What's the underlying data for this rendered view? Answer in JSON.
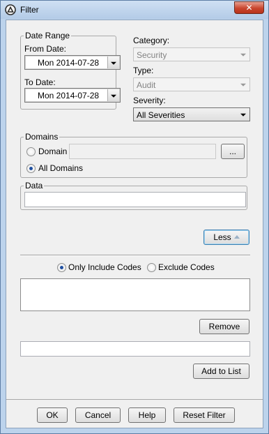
{
  "window": {
    "title": "Filter",
    "close_glyph": "✕",
    "app_icon": "filter-app-icon",
    "close_icon": "close-icon"
  },
  "date_range": {
    "legend": "Date Range",
    "from_label": "From Date:",
    "from_value": "Mon 2014-07-28",
    "to_label": "To Date:",
    "to_value": "Mon 2014-07-28"
  },
  "category": {
    "label": "Category:",
    "value": "Security",
    "enabled": false
  },
  "type": {
    "label": "Type:",
    "value": "Audit",
    "enabled": false
  },
  "severity": {
    "label": "Severity:",
    "value": "All Severities",
    "enabled": true
  },
  "domains": {
    "legend": "Domains",
    "domain_label": "Domain",
    "domain_value": "",
    "browse_label": "...",
    "all_label": "All Domains",
    "selected": "All Domains"
  },
  "data_group": {
    "legend": "Data",
    "value": ""
  },
  "less_button": {
    "label": "Less"
  },
  "codes": {
    "include_label": "Only Include Codes",
    "exclude_label": "Exclude Codes",
    "selected": "Only Include Codes",
    "list": [],
    "remove_label": "Remove",
    "input_value": "",
    "add_label": "Add to List"
  },
  "footer": {
    "ok": "OK",
    "cancel": "Cancel",
    "help": "Help",
    "reset": "Reset Filter"
  },
  "colors": {
    "frame": "#bcd3ec",
    "client": "#f0f0f0",
    "close": "#c9462e",
    "radio_dot": "#1f4fa0"
  }
}
